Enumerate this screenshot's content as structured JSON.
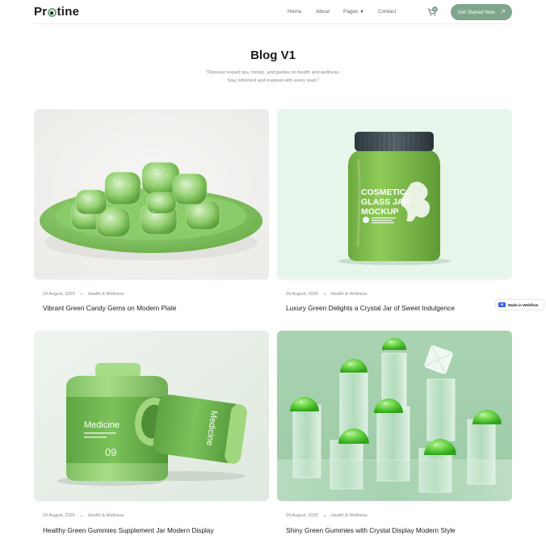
{
  "header": {
    "logo_prefix": "Pr",
    "logo_suffix": "tine",
    "nav": [
      "Home",
      "About",
      "Pages",
      "Contact"
    ],
    "cart_count": "0",
    "cta_label": "Get Started Now",
    "cta_icon": "arrow-up-right-icon"
  },
  "hero": {
    "title": "Blog V1",
    "subtitle_line1": "\"Discover expert tips, trends, and guides on health and wellness.",
    "subtitle_line2": "Stay informed and inspired with every read.\""
  },
  "posts": [
    {
      "date": "24 August, 2025",
      "category": "Health & Wellness",
      "title": "Vibrant Green Candy Gems on Modern Plate",
      "image": "green-candy-plate-image"
    },
    {
      "date": "24 August, 2025",
      "category": "Health & Wellness",
      "title": "Luxury Green Delights a Crystal Jar of Sweet Indulgence",
      "image": "cosmetic-glass-jar-image",
      "jar_text": [
        "COSMETIC",
        "GLASS JAR",
        "MOCKUP"
      ]
    },
    {
      "date": "24 August, 2025",
      "category": "Health & Wellness",
      "title": "Healthy Green Gummies Supplement Jar Modern Display",
      "image": "medicine-bottles-image",
      "bottle_text": "Medicine"
    },
    {
      "date": "24 August, 2025",
      "category": "Health & Wellness",
      "title": "Shiny Green Gummies with Crystal Display Modern Style",
      "image": "crystal-gummies-image"
    }
  ],
  "badge": {
    "label": "Made in Webflow"
  },
  "colors": {
    "accent": "#7fa58c",
    "text": "#1a1a1a",
    "muted": "#888888"
  }
}
